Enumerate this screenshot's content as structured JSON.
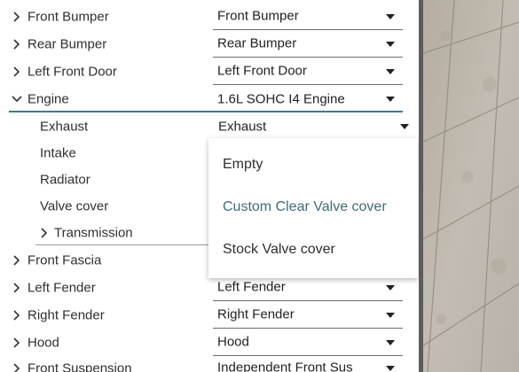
{
  "parts": {
    "front_bumper": {
      "label": "Front Bumper",
      "value": "Front Bumper"
    },
    "rear_bumper": {
      "label": "Rear Bumper",
      "value": "Rear Bumper"
    },
    "left_front_door": {
      "label": "Left Front Door",
      "value": "Left Front Door"
    },
    "engine": {
      "label": "Engine",
      "value": "1.6L SOHC I4 Engine",
      "children": {
        "exhaust": {
          "label": "Exhaust",
          "value": "Exhaust"
        },
        "intake": {
          "label": "Intake"
        },
        "radiator": {
          "label": "Radiator"
        },
        "valve_cover": {
          "label": "Valve cover"
        },
        "transmission": {
          "label": "Transmission"
        }
      }
    },
    "front_fascia": {
      "label": "Front Fascia"
    },
    "left_fender": {
      "label": "Left Fender",
      "value": "Left Fender"
    },
    "right_fender": {
      "label": "Right Fender",
      "value": "Right Fender"
    },
    "hood": {
      "label": "Hood",
      "value": "Hood"
    },
    "front_suspension": {
      "label": "Front Suspension",
      "value": "Independent Front Sus"
    }
  },
  "dropdown": {
    "options": [
      "Empty",
      "Custom Clear Valve cover",
      "Stock Valve cover"
    ],
    "highlighted": "Custom Clear Valve cover"
  },
  "colors": {
    "accent": "#3f6a79",
    "text": "#2f2f2f",
    "panel_bg": "#ffffff",
    "viewport_ground": "#bdb6ac"
  },
  "icons": {
    "collapsed": "chevron-right-icon",
    "expanded": "chevron-down-icon",
    "select": "caret-down-icon"
  }
}
